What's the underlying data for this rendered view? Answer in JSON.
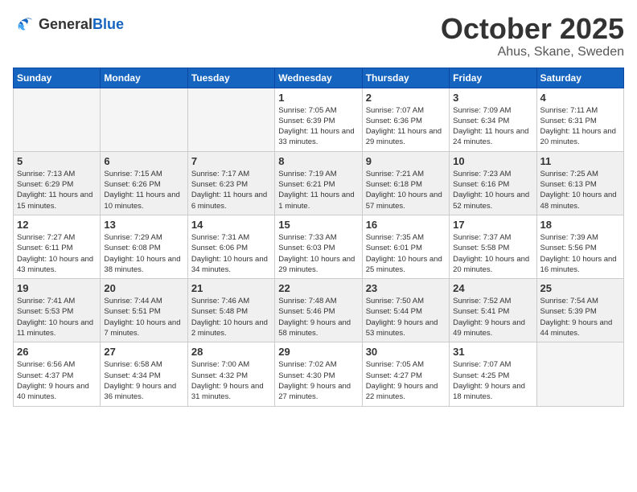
{
  "logo": {
    "general": "General",
    "blue": "Blue"
  },
  "title": {
    "month": "October 2025",
    "location": "Ahus, Skane, Sweden"
  },
  "headers": [
    "Sunday",
    "Monday",
    "Tuesday",
    "Wednesday",
    "Thursday",
    "Friday",
    "Saturday"
  ],
  "weeks": [
    {
      "shaded": false,
      "days": [
        {
          "num": "",
          "info": "",
          "empty": true
        },
        {
          "num": "",
          "info": "",
          "empty": true
        },
        {
          "num": "",
          "info": "",
          "empty": true
        },
        {
          "num": "1",
          "info": "Sunrise: 7:05 AM\nSunset: 6:39 PM\nDaylight: 11 hours\nand 33 minutes."
        },
        {
          "num": "2",
          "info": "Sunrise: 7:07 AM\nSunset: 6:36 PM\nDaylight: 11 hours\nand 29 minutes."
        },
        {
          "num": "3",
          "info": "Sunrise: 7:09 AM\nSunset: 6:34 PM\nDaylight: 11 hours\nand 24 minutes."
        },
        {
          "num": "4",
          "info": "Sunrise: 7:11 AM\nSunset: 6:31 PM\nDaylight: 11 hours\nand 20 minutes."
        }
      ]
    },
    {
      "shaded": true,
      "days": [
        {
          "num": "5",
          "info": "Sunrise: 7:13 AM\nSunset: 6:29 PM\nDaylight: 11 hours\nand 15 minutes."
        },
        {
          "num": "6",
          "info": "Sunrise: 7:15 AM\nSunset: 6:26 PM\nDaylight: 11 hours\nand 10 minutes."
        },
        {
          "num": "7",
          "info": "Sunrise: 7:17 AM\nSunset: 6:23 PM\nDaylight: 11 hours\nand 6 minutes."
        },
        {
          "num": "8",
          "info": "Sunrise: 7:19 AM\nSunset: 6:21 PM\nDaylight: 11 hours\nand 1 minute."
        },
        {
          "num": "9",
          "info": "Sunrise: 7:21 AM\nSunset: 6:18 PM\nDaylight: 10 hours\nand 57 minutes."
        },
        {
          "num": "10",
          "info": "Sunrise: 7:23 AM\nSunset: 6:16 PM\nDaylight: 10 hours\nand 52 minutes."
        },
        {
          "num": "11",
          "info": "Sunrise: 7:25 AM\nSunset: 6:13 PM\nDaylight: 10 hours\nand 48 minutes."
        }
      ]
    },
    {
      "shaded": false,
      "days": [
        {
          "num": "12",
          "info": "Sunrise: 7:27 AM\nSunset: 6:11 PM\nDaylight: 10 hours\nand 43 minutes."
        },
        {
          "num": "13",
          "info": "Sunrise: 7:29 AM\nSunset: 6:08 PM\nDaylight: 10 hours\nand 38 minutes."
        },
        {
          "num": "14",
          "info": "Sunrise: 7:31 AM\nSunset: 6:06 PM\nDaylight: 10 hours\nand 34 minutes."
        },
        {
          "num": "15",
          "info": "Sunrise: 7:33 AM\nSunset: 6:03 PM\nDaylight: 10 hours\nand 29 minutes."
        },
        {
          "num": "16",
          "info": "Sunrise: 7:35 AM\nSunset: 6:01 PM\nDaylight: 10 hours\nand 25 minutes."
        },
        {
          "num": "17",
          "info": "Sunrise: 7:37 AM\nSunset: 5:58 PM\nDaylight: 10 hours\nand 20 minutes."
        },
        {
          "num": "18",
          "info": "Sunrise: 7:39 AM\nSunset: 5:56 PM\nDaylight: 10 hours\nand 16 minutes."
        }
      ]
    },
    {
      "shaded": true,
      "days": [
        {
          "num": "19",
          "info": "Sunrise: 7:41 AM\nSunset: 5:53 PM\nDaylight: 10 hours\nand 11 minutes."
        },
        {
          "num": "20",
          "info": "Sunrise: 7:44 AM\nSunset: 5:51 PM\nDaylight: 10 hours\nand 7 minutes."
        },
        {
          "num": "21",
          "info": "Sunrise: 7:46 AM\nSunset: 5:48 PM\nDaylight: 10 hours\nand 2 minutes."
        },
        {
          "num": "22",
          "info": "Sunrise: 7:48 AM\nSunset: 5:46 PM\nDaylight: 9 hours\nand 58 minutes."
        },
        {
          "num": "23",
          "info": "Sunrise: 7:50 AM\nSunset: 5:44 PM\nDaylight: 9 hours\nand 53 minutes."
        },
        {
          "num": "24",
          "info": "Sunrise: 7:52 AM\nSunset: 5:41 PM\nDaylight: 9 hours\nand 49 minutes."
        },
        {
          "num": "25",
          "info": "Sunrise: 7:54 AM\nSunset: 5:39 PM\nDaylight: 9 hours\nand 44 minutes."
        }
      ]
    },
    {
      "shaded": false,
      "days": [
        {
          "num": "26",
          "info": "Sunrise: 6:56 AM\nSunset: 4:37 PM\nDaylight: 9 hours\nand 40 minutes."
        },
        {
          "num": "27",
          "info": "Sunrise: 6:58 AM\nSunset: 4:34 PM\nDaylight: 9 hours\nand 36 minutes."
        },
        {
          "num": "28",
          "info": "Sunrise: 7:00 AM\nSunset: 4:32 PM\nDaylight: 9 hours\nand 31 minutes."
        },
        {
          "num": "29",
          "info": "Sunrise: 7:02 AM\nSunset: 4:30 PM\nDaylight: 9 hours\nand 27 minutes."
        },
        {
          "num": "30",
          "info": "Sunrise: 7:05 AM\nSunset: 4:27 PM\nDaylight: 9 hours\nand 22 minutes."
        },
        {
          "num": "31",
          "info": "Sunrise: 7:07 AM\nSunset: 4:25 PM\nDaylight: 9 hours\nand 18 minutes."
        },
        {
          "num": "",
          "info": "",
          "empty": true
        }
      ]
    }
  ]
}
